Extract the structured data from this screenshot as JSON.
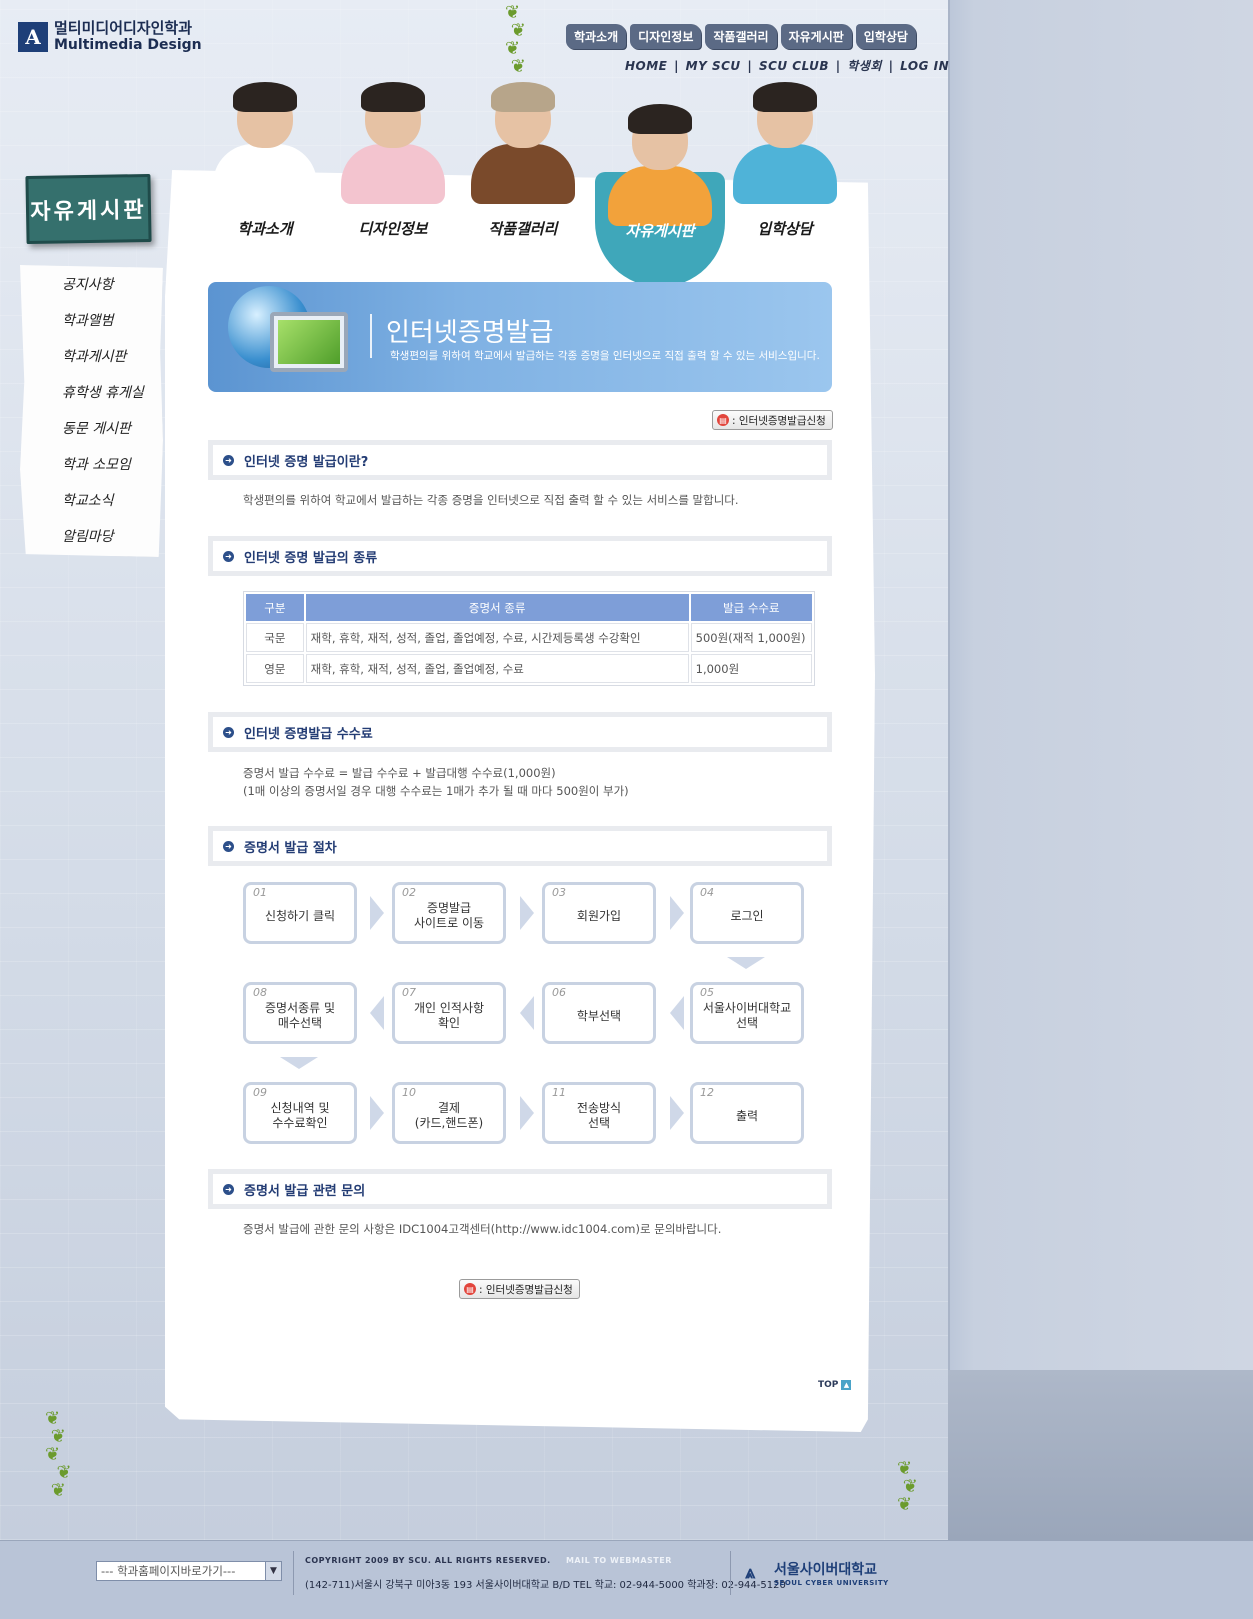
{
  "site": {
    "logo_ko": "멀티미디어디자인학과",
    "logo_en": "Multimedia Design",
    "logo_mark": "A"
  },
  "top_nav": [
    "학과소개",
    "디자인정보",
    "작품갤러리",
    "자유게시판",
    "입학상담"
  ],
  "sub_nav": [
    "HOME",
    "MY SCU",
    "SCU CLUB",
    "학생회",
    "LOG IN"
  ],
  "sub_nav_separator": "|",
  "char_nav": [
    {
      "label": "학과소개",
      "hair": "#2b2420",
      "body": "#ffffff",
      "active": false
    },
    {
      "label": "디자인정보",
      "hair": "#2b2420",
      "body": "#f3c4cf",
      "active": false
    },
    {
      "label": "작품갤러리",
      "hair": "#b7a58a",
      "body": "#7a4a2b",
      "active": false
    },
    {
      "label": "자유게시판",
      "hair": "#2b2420",
      "body": "#f2a23b",
      "active": true
    },
    {
      "label": "입학상담",
      "hair": "#2b2420",
      "body": "#4fb3d8",
      "active": false
    }
  ],
  "side": {
    "title": "자유게시판",
    "menu": [
      "공지사항",
      "학과앨범",
      "학과게시판",
      "휴학생 휴게실",
      "동문 게시판",
      "학과 소모임",
      "학교소식",
      "알림마당"
    ]
  },
  "banner": {
    "title": "인터넷증명발급",
    "desc": "학생편의를 위하여 학교에서 발급하는 각종 증명을 인터넷으로 직접 출력 할 수 있는 서비스입니다."
  },
  "apply_button": {
    "label": ": 인터넷증명발급신청",
    "icon": "form-icon"
  },
  "sections": {
    "what": {
      "title": "인터넷 증명 발급이란?",
      "text": "학생편의를 위하여 학교에서 발급하는 각종 증명을 인터넷으로 직접 출력 할 수 있는 서비스를 말합니다."
    },
    "types": {
      "title": "인터넷 증명 발급의 종류",
      "table": {
        "headers": [
          "구분",
          "증명서 종류",
          "발급 수수료"
        ],
        "rows": [
          [
            "국문",
            "재학, 휴학, 재적, 성적, 졸업, 졸업예정, 수료, 시간제등록생 수강확인",
            "500원(재적 1,000원)"
          ],
          [
            "영문",
            "재학, 휴학, 재적, 성적, 졸업, 졸업예정, 수료",
            "1,000원"
          ]
        ]
      }
    },
    "fee": {
      "title": "인터넷 증명발급 수수료",
      "line1": "증명서 발급 수수료 = 발급 수수료 + 발급대행 수수료(1,000원)",
      "line2": "(1매 이상의 증명서일 경우 대행 수수료는 1매가 추가 될 때 마다 500원이 부가)"
    },
    "procedure": {
      "title": "증명서 발급 절차",
      "steps": [
        {
          "num": "01",
          "label": "신청하기 클릭"
        },
        {
          "num": "02",
          "label": "증명발급\n사이트로 이동"
        },
        {
          "num": "03",
          "label": "회원가입"
        },
        {
          "num": "04",
          "label": "로그인"
        },
        {
          "num": "05",
          "label": "서울사이버대학교\n선택"
        },
        {
          "num": "06",
          "label": "학부선택"
        },
        {
          "num": "07",
          "label": "개인 인적사항\n확인"
        },
        {
          "num": "08",
          "label": "증명서종류 및\n매수선택"
        },
        {
          "num": "09",
          "label": "신청내역 및\n수수료확인"
        },
        {
          "num": "10",
          "label": "결제\n(카드,핸드폰)"
        },
        {
          "num": "11",
          "label": "전송방식\n선택"
        },
        {
          "num": "12",
          "label": "출력"
        }
      ]
    },
    "inquiry": {
      "title": "증명서 발급 관련 문의",
      "text": "증명서 발급에 관한 문의 사항은 IDC1004고객센터(http://www.idc1004.com)로 문의바랍니다."
    }
  },
  "top_link": "TOP",
  "footer": {
    "select_value": "--- 학과홈페이지바로가기---",
    "copyright": "COPYRIGHT 2009 BY SCU. ALL RIGHTS RESERVED.",
    "mail": "MAIL TO WEBMASTER",
    "address": "(142-711)서울시 강북구 미아3동 193 서울사이버대학교 B/D   TEL  학교: 02-944-5000   학과장: 02-944-5120",
    "logo_ko": "서울사이버대학교",
    "logo_en": "SEOUL CYBER UNIVERSITY"
  },
  "colors": {
    "accent": "#233c74",
    "banner": "#7fb1e3",
    "table_header": "#7e9ed8",
    "active_tab": "#3fa7ba"
  }
}
